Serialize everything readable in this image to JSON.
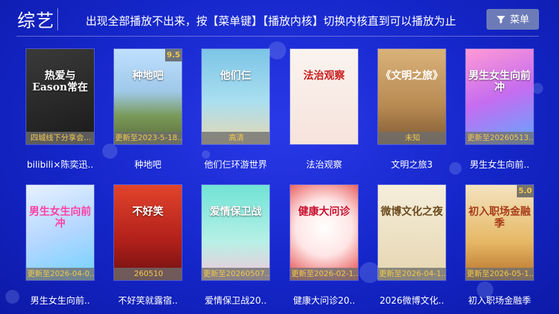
{
  "header": {
    "title": "综艺",
    "notice": "出现全部播放不出来，按【菜单键】【播放内核】切换内核直到可以播放为止",
    "menu_label": "菜单"
  },
  "colors": {
    "background": "#1526c9",
    "status_text": "#f4c94b",
    "menu_button": "#6c7bb8"
  },
  "items": [
    {
      "name": "bilibili×陈奕迅..",
      "status": "四城线下分享会...",
      "rating": "",
      "poster_text": "热爱与Eason常在",
      "art": "dark"
    },
    {
      "name": "种地吧",
      "status": "更新至2023-5-18..",
      "rating": "9.5",
      "poster_text": "种地吧",
      "art": "field"
    },
    {
      "name": "他们仨环游世界",
      "status": "高清",
      "rating": "",
      "poster_text": "他们仨",
      "art": "sky"
    },
    {
      "name": "法治观察",
      "status": "",
      "rating": "",
      "poster_text": "法治观察",
      "art": "ink"
    },
    {
      "name": "文明之旅3",
      "status": "未知",
      "rating": "",
      "poster_text": "《文明之旅》",
      "art": "tan"
    },
    {
      "name": "男生女生向前..",
      "status": "更新至20260513..",
      "rating": "",
      "poster_text": "男生女生向前冲",
      "art": "pink"
    },
    {
      "name": "男生女生向前..",
      "status": "更新至2026-04-0..",
      "rating": "",
      "poster_text": "男生女生向前冲",
      "art": "light"
    },
    {
      "name": "不好笑就露宿..",
      "status": "260510",
      "rating": "",
      "poster_text": "不好笑",
      "art": "red"
    },
    {
      "name": "爱情保卫战20..",
      "status": "更新至20260507..",
      "rating": "",
      "poster_text": "爱情保卫战",
      "art": "teal"
    },
    {
      "name": "健康大问诊20..",
      "status": "更新至2026-02-1..",
      "rating": "",
      "poster_text": "健康大问诊",
      "art": "heart"
    },
    {
      "name": "2026微博文化..",
      "status": "更新至2026-04-1..",
      "rating": "",
      "poster_text": "微博文化之夜",
      "art": "cream"
    },
    {
      "name": "初入职场金融季",
      "status": "更新至2026-05-1..",
      "rating": "5.0",
      "poster_text": "初入职场金融季",
      "art": "gold"
    }
  ]
}
